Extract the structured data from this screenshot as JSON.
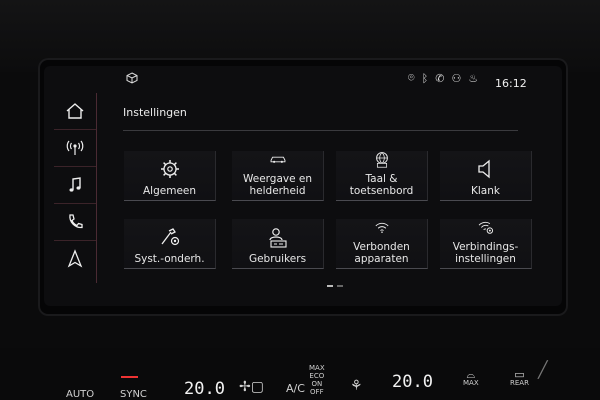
{
  "status": {
    "time": "16:12"
  },
  "page": {
    "title": "Instellingen"
  },
  "sidebar": {
    "items": [
      {
        "icon": "home-icon"
      },
      {
        "icon": "radio-icon"
      },
      {
        "icon": "music-note-icon"
      },
      {
        "icon": "phone-icon"
      },
      {
        "icon": "navigation-arrow-icon"
      }
    ]
  },
  "tiles": [
    {
      "label": "Algemeen",
      "icon": "gear-icon"
    },
    {
      "label": "Weergave en helderheid",
      "icon": "car-display-icon"
    },
    {
      "label": "Taal & toetsenbord",
      "icon": "globe-keyboard-icon"
    },
    {
      "label": "Klank",
      "icon": "speaker-icon"
    },
    {
      "label": "Syst.-onderh.",
      "icon": "wrench-gear-icon"
    },
    {
      "label": "Gebruikers",
      "icon": "user-card-icon"
    },
    {
      "label": "Verbonden apparaten",
      "icon": "wifi-devices-icon"
    },
    {
      "label": "Verbindings-instellingen",
      "icon": "wifi-gear-icon"
    }
  ],
  "climate": {
    "auto": "AUTO",
    "sync": "SYNC",
    "temp_left": "20.0",
    "ac": "A/C",
    "max_eco_on_off": [
      "MAX",
      "ECO",
      "ON",
      "OFF"
    ],
    "temp_right": "20.0",
    "max": "MAX",
    "rear": "REAR"
  },
  "colors": {
    "accent": "#c23a55",
    "sync_led": "#e33333"
  }
}
